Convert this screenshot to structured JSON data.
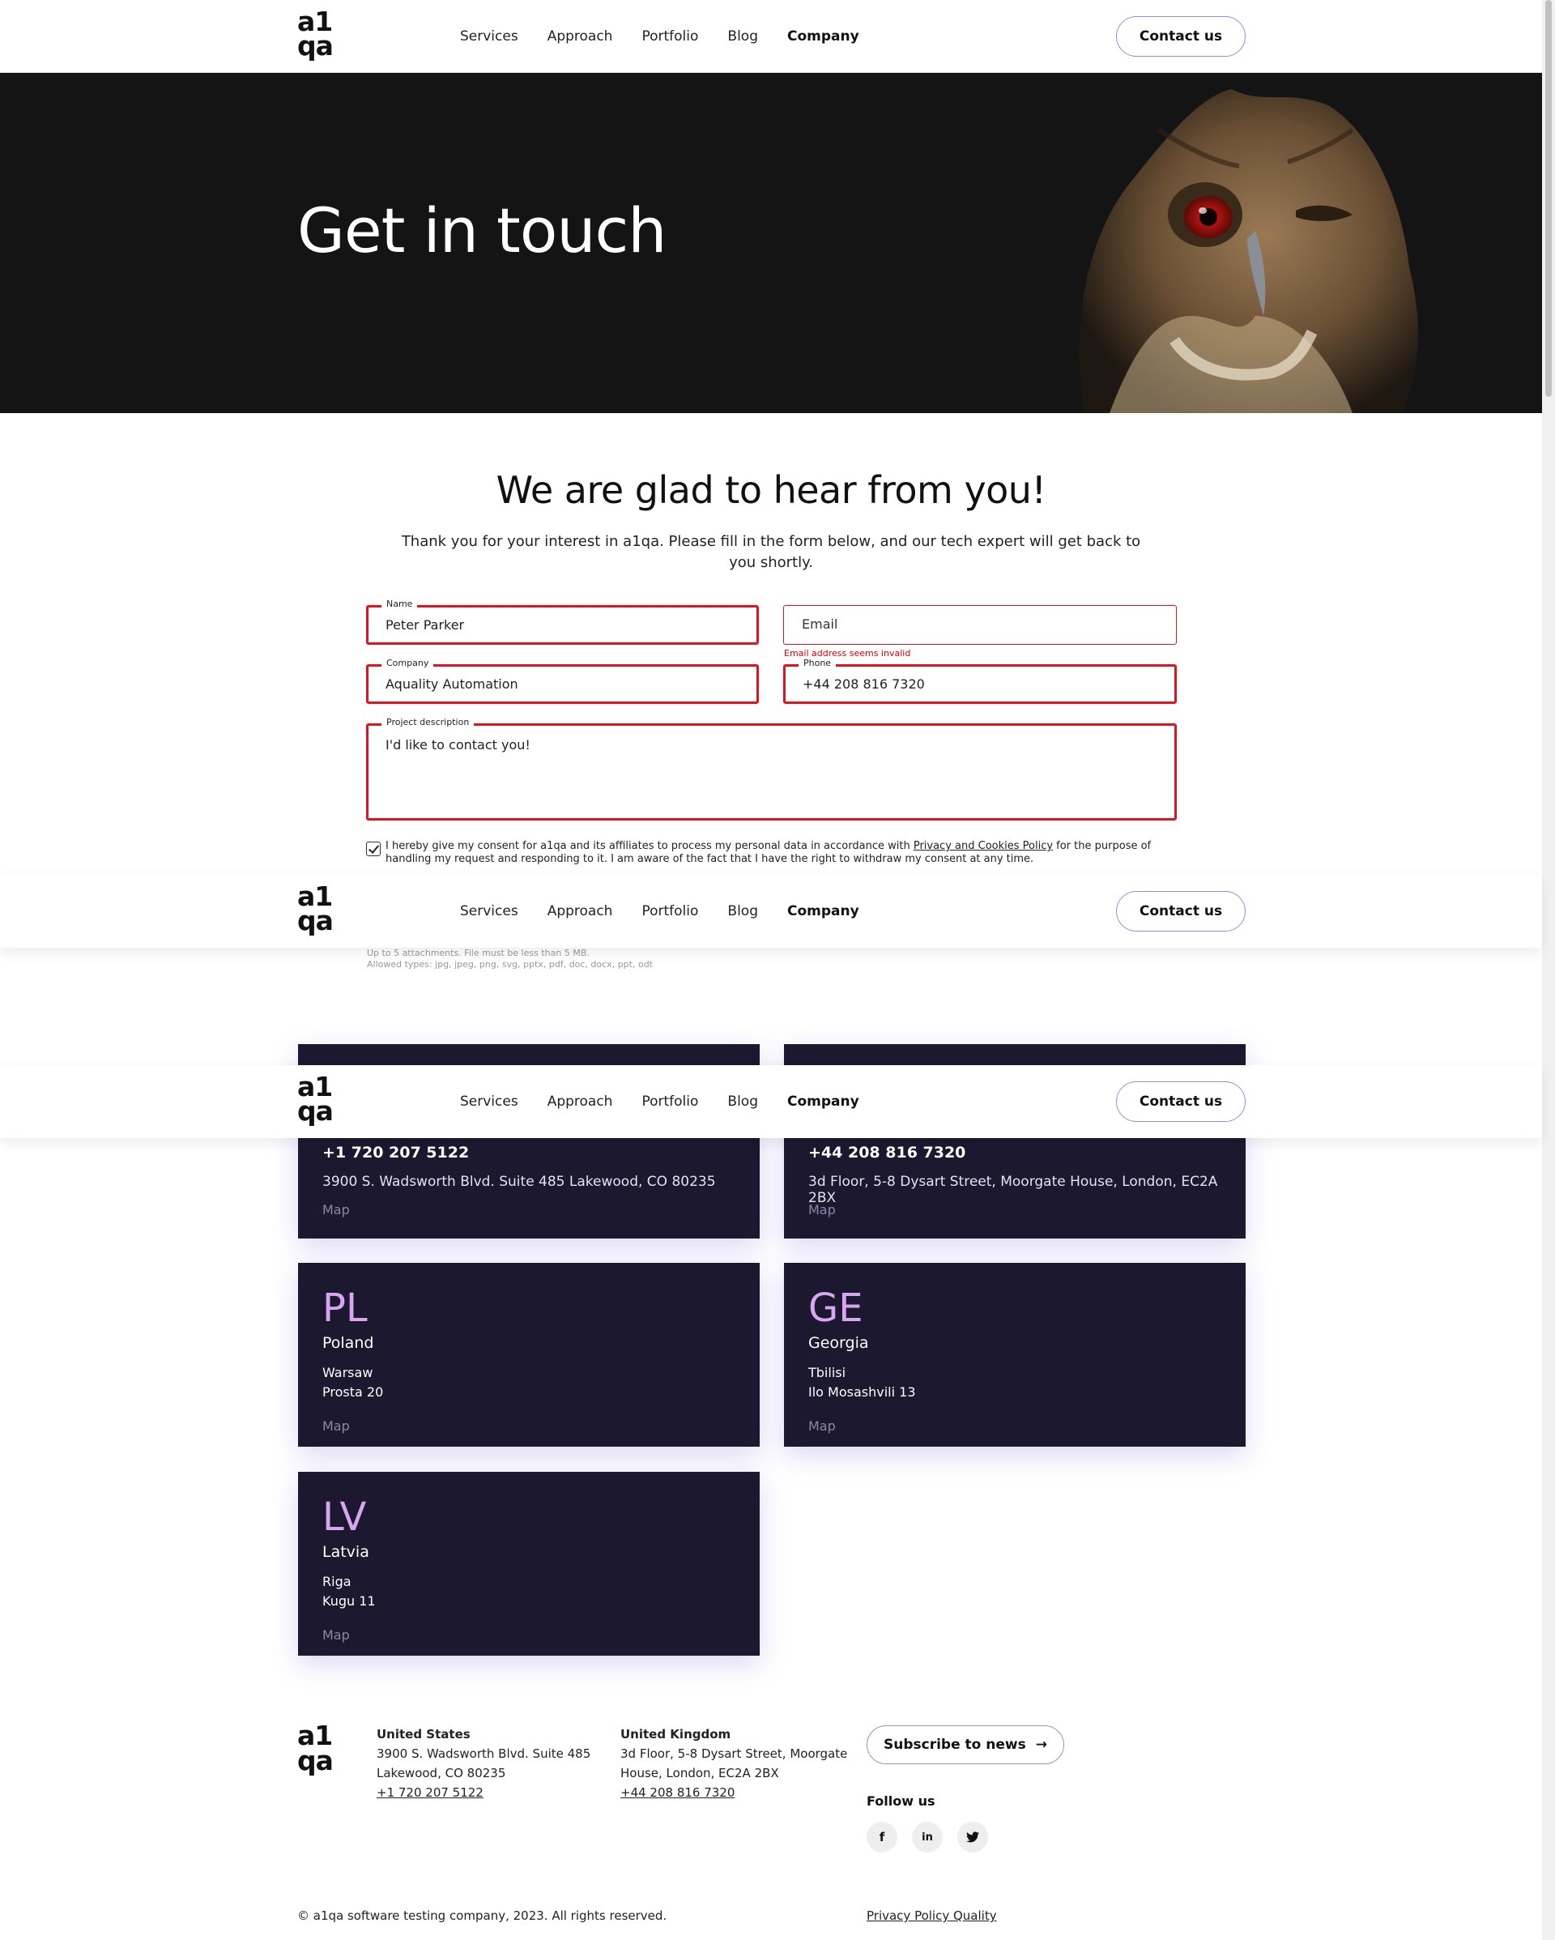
{
  "logo": {
    "line1": "a1",
    "line2": "qa"
  },
  "nav": {
    "items": [
      "Services",
      "Approach",
      "Portfolio",
      "Blog",
      "Company"
    ],
    "active": "Company",
    "contact_label": "Contact us"
  },
  "hero": {
    "title": "Get in touch"
  },
  "form": {
    "title": "We are glad to hear from you!",
    "subtitle": "Thank you for your interest in a1qa. Please fill in the form below, and our tech expert will get back to you shortly.",
    "name": {
      "label": "Name",
      "value": "Peter Parker"
    },
    "email": {
      "placeholder": "Email",
      "error": "Email address seems invalid"
    },
    "company": {
      "label": "Company",
      "value": "Aquality Automation"
    },
    "phone": {
      "label": "Phone",
      "value": "+44 208 816 7320"
    },
    "project": {
      "label": "Project description",
      "value": "I'd like to contact you!"
    },
    "consent": {
      "before": "I hereby give my consent for a1qa and its affiliates to process my personal data in accordance with ",
      "link": "Privacy and Cookies Policy",
      "after": " for the purpose of handling my request and responding to it. I am aware of the fact that I have the right to withdraw my consent at any time.",
      "checked": true
    },
    "attach_note_1": "Up to 5 attachments. File must be less than 5 MB.",
    "attach_note_2": "Allowed types: jpg, jpeg, png, svg, pptx, pdf, doc, docx, ppt, odt"
  },
  "offices": {
    "us": {
      "phone": "+1 720 207 5122",
      "address": "3900 S. Wadsworth Blvd. Suite 485 Lakewood, CO 80235",
      "map": "Map"
    },
    "uk": {
      "phone": "+44 208 816 7320",
      "address": "3d Floor, 5-8 Dysart Street, Moorgate House, London, EC2A 2BX",
      "map": "Map"
    },
    "pl": {
      "code": "PL",
      "country": "Poland",
      "city": "Warsaw",
      "street": "Prosta 20",
      "map": "Map"
    },
    "ge": {
      "code": "GE",
      "country": "Georgia",
      "city": "Tbilisi",
      "street": "Ilo Mosashvili 13",
      "map": "Map"
    },
    "lv": {
      "code": "LV",
      "country": "Latvia",
      "city": "Riga",
      "street": "Kugu 11",
      "map": "Map"
    }
  },
  "footer": {
    "us": {
      "title": "United States",
      "line1": "3900 S. Wadsworth Blvd. Suite 485",
      "line2": "Lakewood, CO 80235",
      "phone": "+1 720 207 5122"
    },
    "uk": {
      "title": "United Kingdom",
      "line1": "3d Floor, 5-8 Dysart Street, Moorgate",
      "line2": "House, London, EC2A 2BX",
      "phone": "+44 208 816 7320"
    },
    "subscribe": "Subscribe to news",
    "follow": "Follow us",
    "social": {
      "facebook": "f",
      "linkedin": "in",
      "twitter": "t"
    },
    "copyright": "© a1qa software testing company, 2023. All rights reserved.",
    "privacy": "Privacy Policy Quality"
  },
  "colors": {
    "accent": "#9b8ae0",
    "card_bg": "#1b1830",
    "code_color": "#d8a6f0",
    "error": "#e0141e"
  }
}
